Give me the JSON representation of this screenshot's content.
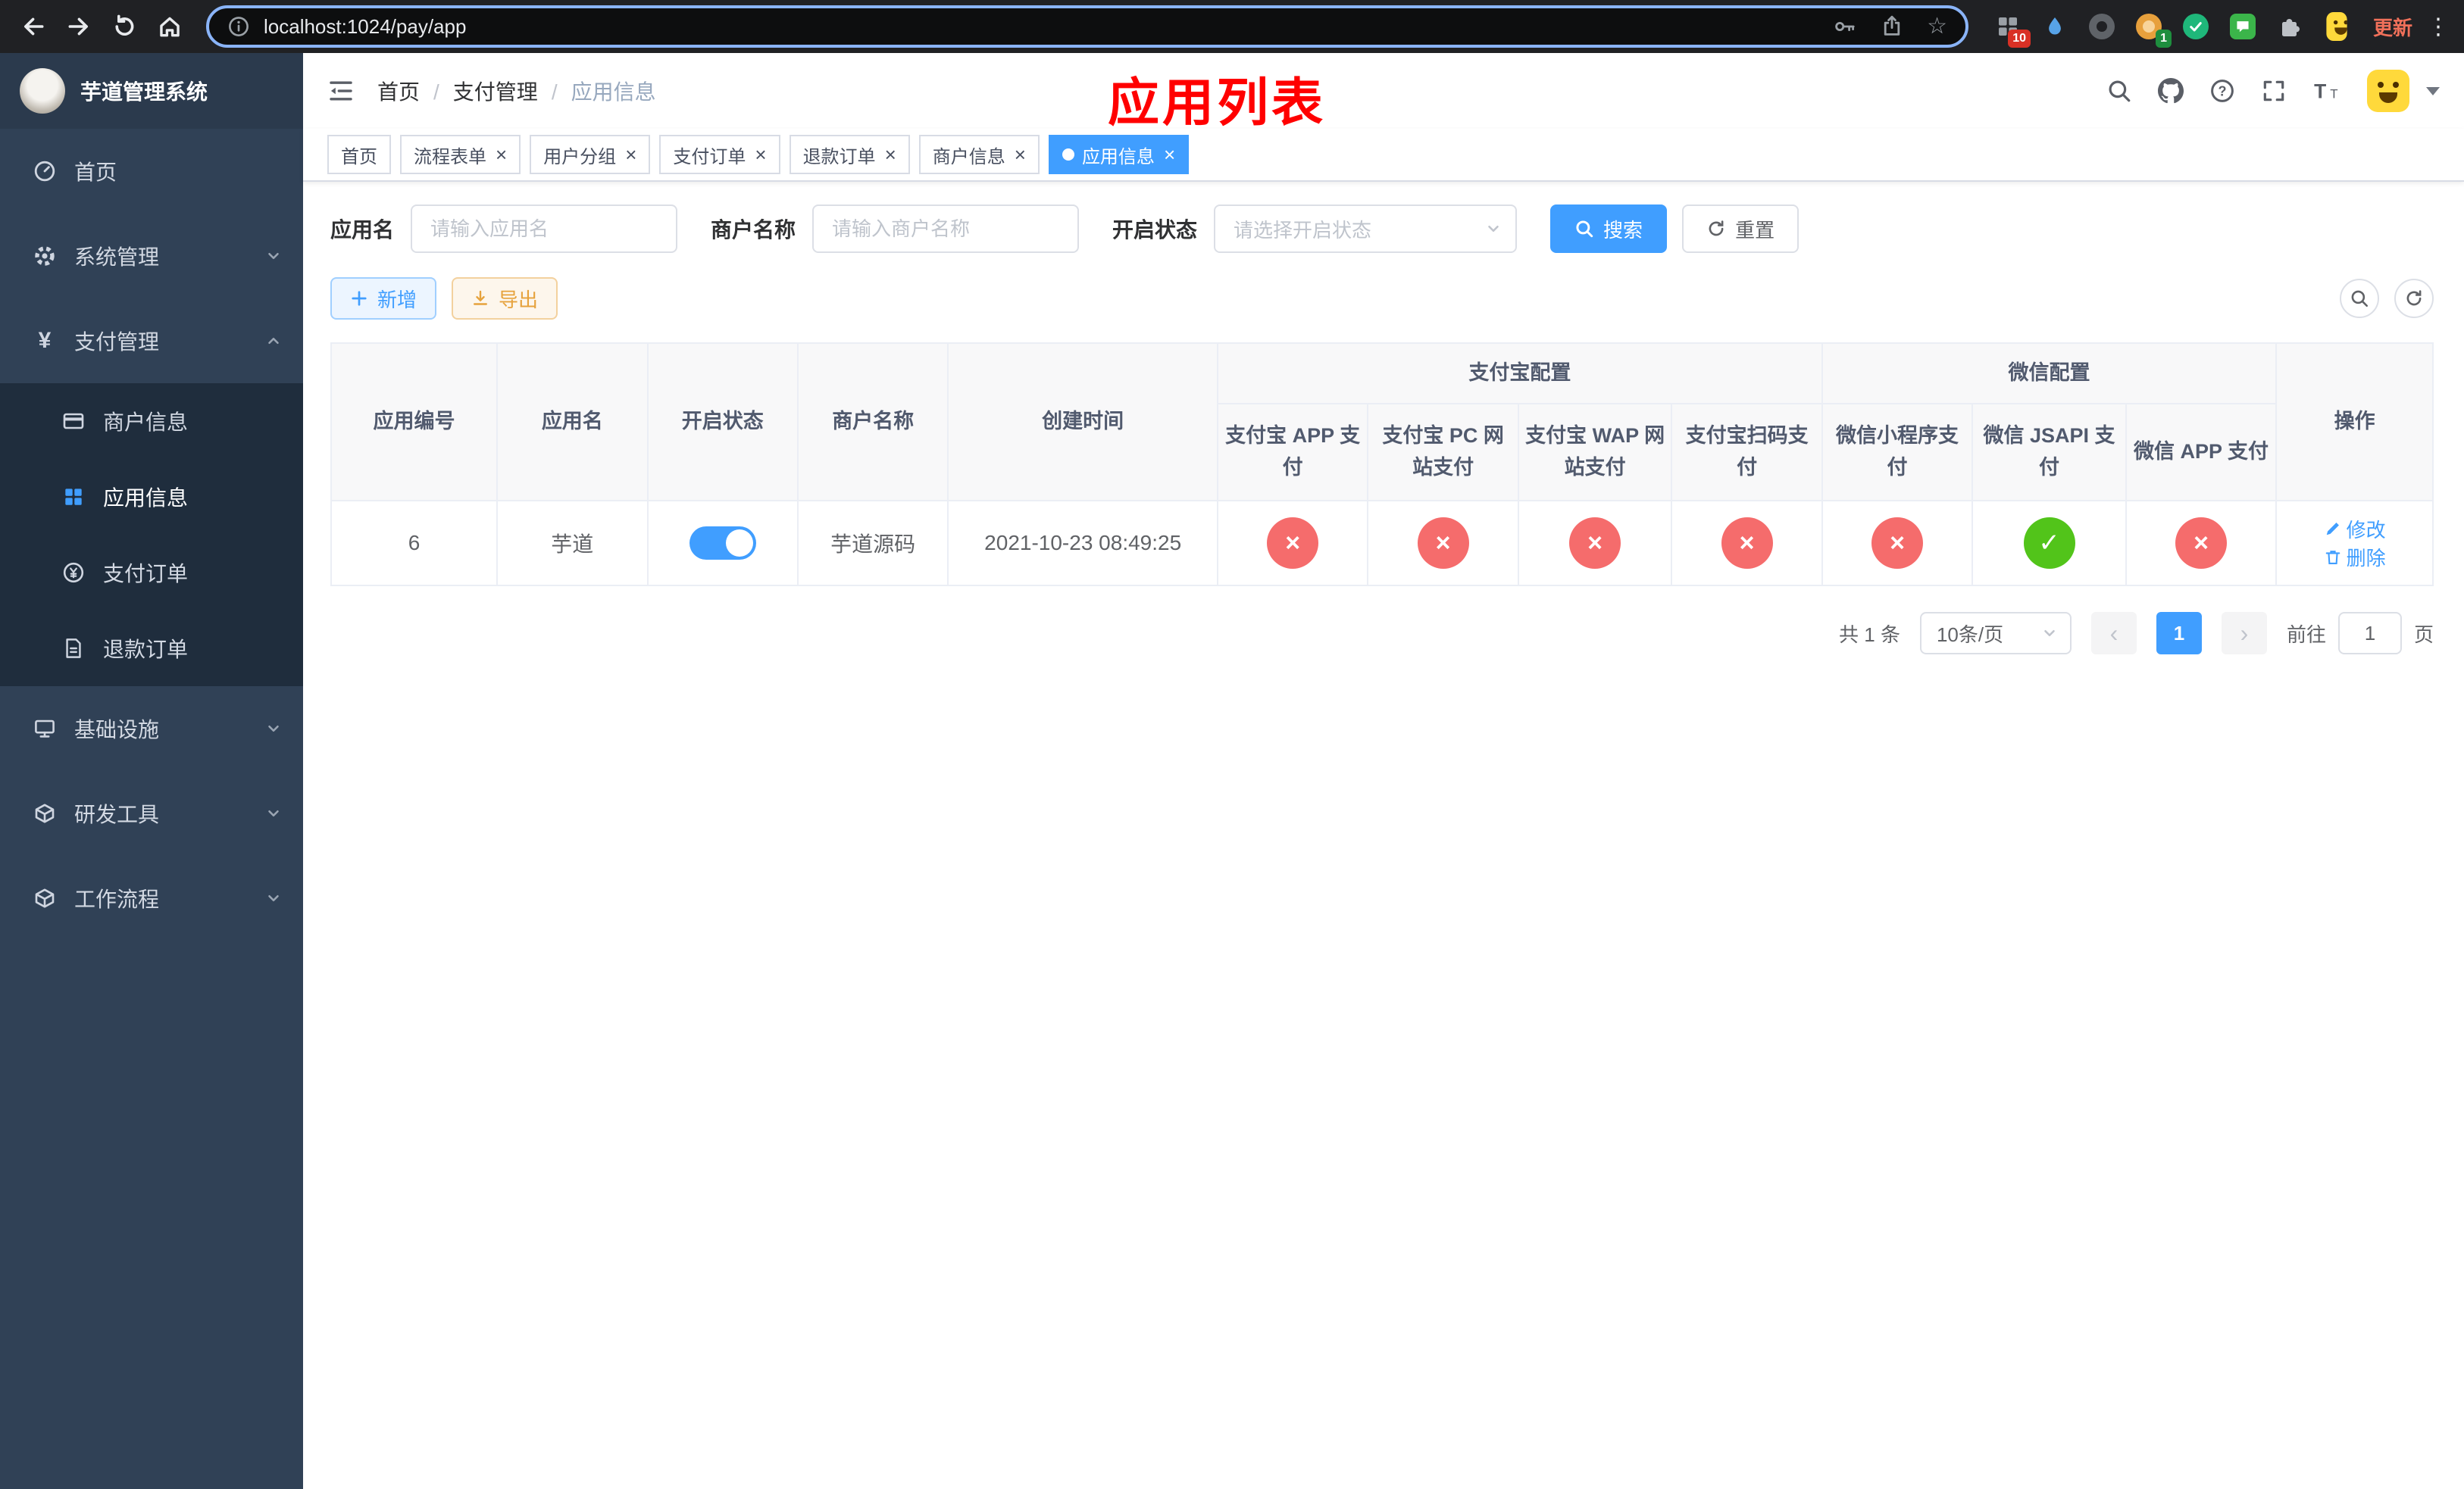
{
  "colors": {
    "accent": "#409eff",
    "danger": "#f56c6c",
    "success": "#52c41a",
    "warning": "#e6a23c",
    "annotation": "#ff0000"
  },
  "browser": {
    "url": "localhost:1024/pay/app",
    "update_label": "更新",
    "ext_badge": "10",
    "profile_badge": "1"
  },
  "sidebar": {
    "title": "芋道管理系统",
    "items": [
      {
        "label": "首页"
      },
      {
        "label": "系统管理"
      },
      {
        "label": "支付管理",
        "children": [
          {
            "label": "商户信息"
          },
          {
            "label": "应用信息",
            "active": true
          },
          {
            "label": "支付订单"
          },
          {
            "label": "退款订单"
          }
        ]
      },
      {
        "label": "基础设施"
      },
      {
        "label": "研发工具"
      },
      {
        "label": "工作流程"
      }
    ]
  },
  "navbar": {
    "breadcrumb": [
      "首页",
      "支付管理",
      "应用信息"
    ],
    "annotation": "应用列表"
  },
  "tags": [
    {
      "label": "首页",
      "closable": false,
      "active": false
    },
    {
      "label": "流程表单",
      "closable": true,
      "active": false
    },
    {
      "label": "用户分组",
      "closable": true,
      "active": false
    },
    {
      "label": "支付订单",
      "closable": true,
      "active": false
    },
    {
      "label": "退款订单",
      "closable": true,
      "active": false
    },
    {
      "label": "商户信息",
      "closable": true,
      "active": false
    },
    {
      "label": "应用信息",
      "closable": true,
      "active": true
    }
  ],
  "filters": {
    "app_name_label": "应用名",
    "app_name_placeholder": "请输入应用名",
    "merchant_label": "商户名称",
    "merchant_placeholder": "请输入商户名称",
    "status_label": "开启状态",
    "status_placeholder": "请选择开启状态",
    "search_label": "搜索",
    "reset_label": "重置"
  },
  "toolbar": {
    "add_label": "新增",
    "export_label": "导出"
  },
  "table": {
    "headers": [
      "应用编号",
      "应用名",
      "开启状态",
      "商户名称",
      "创建时间"
    ],
    "groups": [
      {
        "label": "支付宝配置",
        "children": [
          "支付宝 APP 支付",
          "支付宝 PC 网站支付",
          "支付宝 WAP 网站支付",
          "支付宝扫码支付"
        ]
      },
      {
        "label": "微信配置",
        "children": [
          "微信小程序支付",
          "微信 JSAPI 支付",
          "微信 APP 支付"
        ]
      }
    ],
    "ops_header": "操作",
    "row": {
      "id": "6",
      "name": "芋道",
      "enabled": true,
      "merchant": "芋道源码",
      "created": "2021-10-23 08:49:25",
      "configs": [
        false,
        false,
        false,
        false,
        false,
        true,
        false
      ],
      "actions": [
        "修改",
        "删除"
      ]
    }
  },
  "pagination": {
    "total": "共 1 条",
    "page_size": "10条/页",
    "page": "1",
    "goto_prefix": "前往",
    "goto_value": "1",
    "goto_suffix": "页"
  }
}
